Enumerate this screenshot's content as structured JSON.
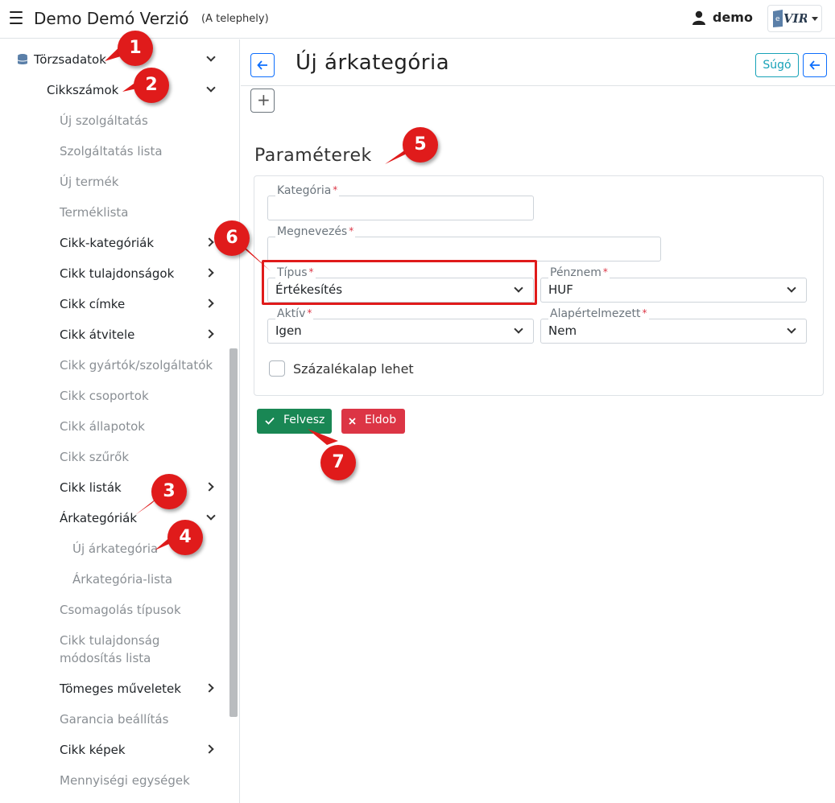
{
  "header": {
    "app_title": "Demo Demó Verzió",
    "app_subtitle": "(A telephely)",
    "user_name": "demo",
    "logo_text": "VIR"
  },
  "sidebar": {
    "root": "Törzsadatok",
    "group": "Cikkszámok",
    "items": [
      "Új szolgáltatás",
      "Szolgáltatás lista",
      "Új termék",
      "Terméklista",
      "Cikk-kategóriák",
      "Cikk tulajdonságok",
      "Cikk címke",
      "Cikk átvitele",
      "Cikk gyártók/szolgáltatók",
      "Cikk csoportok",
      "Cikk állapotok",
      "Cikk szűrők",
      "Cikk listák",
      "Árkategóriák",
      "Új árkategória",
      "Árkategória-lista",
      "Csomagolás típusok",
      "Cikk tulajdonság",
      "módosítás lista",
      "Tömeges műveletek",
      "Garancia beállítás",
      "Cikk képek",
      "Mennyiségi egységek"
    ]
  },
  "page": {
    "title": "Új árkategória",
    "help_label": "Súgó",
    "section_title": "Paraméterek"
  },
  "form": {
    "category_label": "Kategória",
    "category_value": "",
    "name_label": "Megnevezés",
    "name_value": "",
    "type_label": "Típus",
    "type_value": "Értékesítés",
    "currency_label": "Pénznem",
    "currency_value": "HUF",
    "active_label": "Aktív",
    "active_value": "Igen",
    "default_label": "Alapértelmezett",
    "default_value": "Nem",
    "required_mark": "*",
    "percent_base_label": "Százalékalap lehet"
  },
  "actions": {
    "save_label": "Felvesz",
    "discard_label": "Eldob"
  },
  "annotations": [
    "1",
    "2",
    "3",
    "4",
    "5",
    "6",
    "7"
  ],
  "colors": {
    "primary": "#0d6efd",
    "success": "#198754",
    "danger": "#dc3545",
    "info": "#17a2b8",
    "annotation": "#e01b1b"
  }
}
